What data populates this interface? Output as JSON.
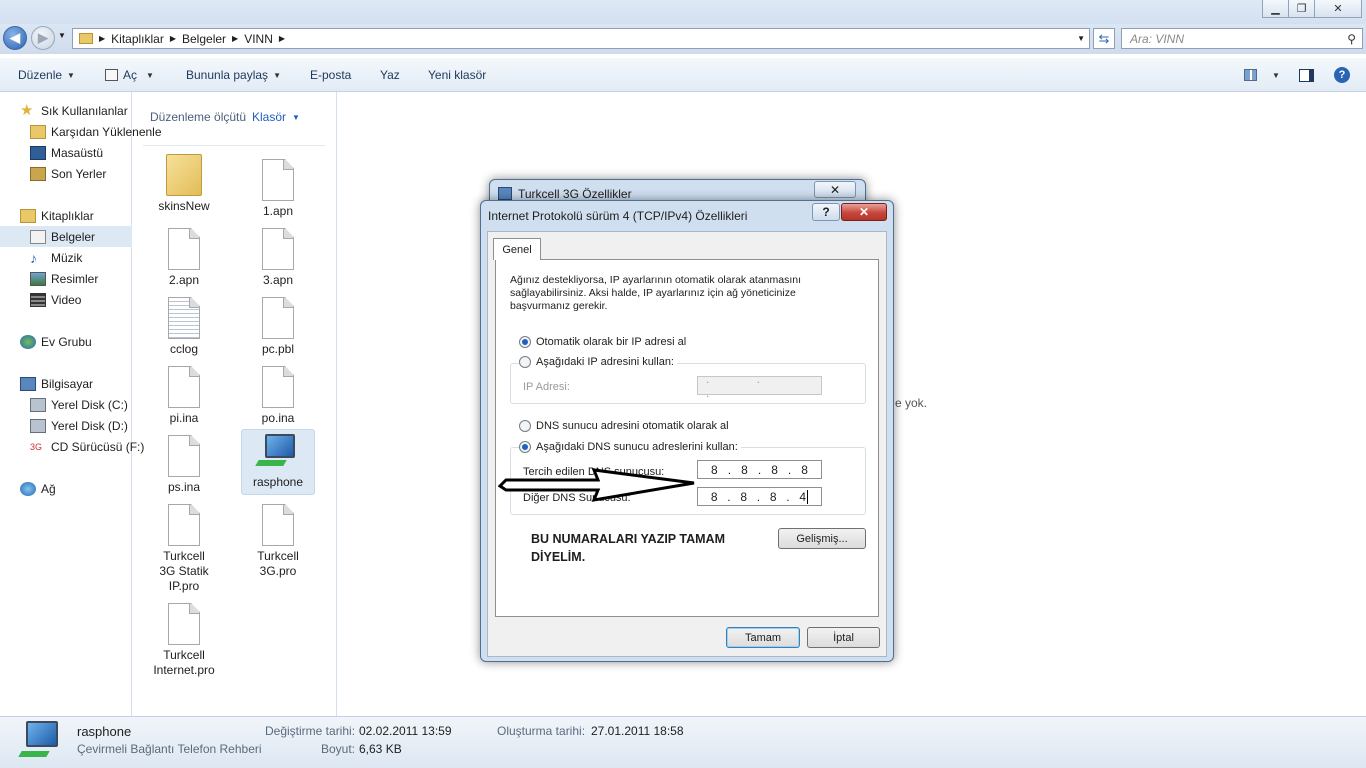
{
  "address": {
    "segments": [
      "Kitaplıklar",
      "Belgeler",
      "VINN"
    ],
    "search_placeholder": "Ara: VINN"
  },
  "toolbar": {
    "organize": "Düzenle",
    "open": "Aç",
    "share": "Bununla paylaş",
    "email": "E-posta",
    "print": "Yaz",
    "new_folder": "Yeni klasör"
  },
  "nav": {
    "favorites": "Sık Kullanılanlar",
    "downloads": "Karşıdan Yüklenenler",
    "desktop": "Masaüstü",
    "recent": "Son Yerler",
    "libraries": "Kitaplıklar",
    "documents": "Belgeler",
    "music": "Müzik",
    "pictures": "Resimler",
    "video": "Video",
    "homegroup": "Ev Grubu",
    "computer": "Bilgisayar",
    "disk_c": "Yerel Disk (C:)",
    "disk_d": "Yerel Disk (D:)",
    "cd": "CD Sürücüsü (F:)",
    "network": "Ağ"
  },
  "library": {
    "arrange_label": "Düzenleme ölçütü",
    "arrange_value": "Klasör"
  },
  "files": [
    "skinsNew",
    "1.apn",
    "2.apn",
    "3.apn",
    "cclog",
    "pc.pbl",
    "pi.ina",
    "po.ina",
    "ps.ina",
    "rasphone",
    "Turkcell 3G Statik IP.pro",
    "Turkcell 3G.pro",
    "Turkcell Internet.pro"
  ],
  "partial_text": "e yok.",
  "status": {
    "name": "rasphone",
    "type": "Çevirmeli Bağlantı Telefon Rehberi",
    "modified_label": "Değiştirme tarihi:",
    "modified": "02.02.2011 13:59",
    "created_label": "Oluşturma tarihi:",
    "created": "27.01.2011 18:58",
    "size_label": "Boyut:",
    "size": "6,63 KB"
  },
  "back_dialog": {
    "title": "Turkcell 3G Özellikler"
  },
  "dialog": {
    "title": "Internet Protokolü sürüm 4 (TCP/IPv4) Özellikleri",
    "help": "?",
    "tab": "Genel",
    "description": "Ağınız destekliyorsa, IP ayarlarının otomatik olarak atanmasını sağlayabilirsiniz. Aksi halde, IP ayarlarınız için ağ yöneticinize başvurmanız gerekir.",
    "auto_ip": "Otomatik olarak bir IP adresi al",
    "manual_ip": "Aşağıdaki IP adresini kullan:",
    "ip_label": "IP Adresi:",
    "ip_dots": ". . .",
    "auto_dns": "DNS sunucu adresini otomatik olarak al",
    "manual_dns": "Aşağıdaki DNS sunucu adreslerini kullan:",
    "preferred_label": "Tercih edilen DNS sunucusu:",
    "preferred": [
      "8",
      "8",
      "8",
      "8"
    ],
    "alternate_label": "Diğer DNS Sunucusu:",
    "alternate": [
      "8",
      "8",
      "8",
      "4"
    ],
    "note": "BU NUMARALARI YAZIP TAMAM DİYELİM.",
    "advanced": "Gelişmiş...",
    "ok": "Tamam",
    "cancel": "İptal"
  },
  "colors": {
    "accent": "#1f5fbf",
    "close_red": "#c7463a",
    "selection": "#dde8f5"
  }
}
